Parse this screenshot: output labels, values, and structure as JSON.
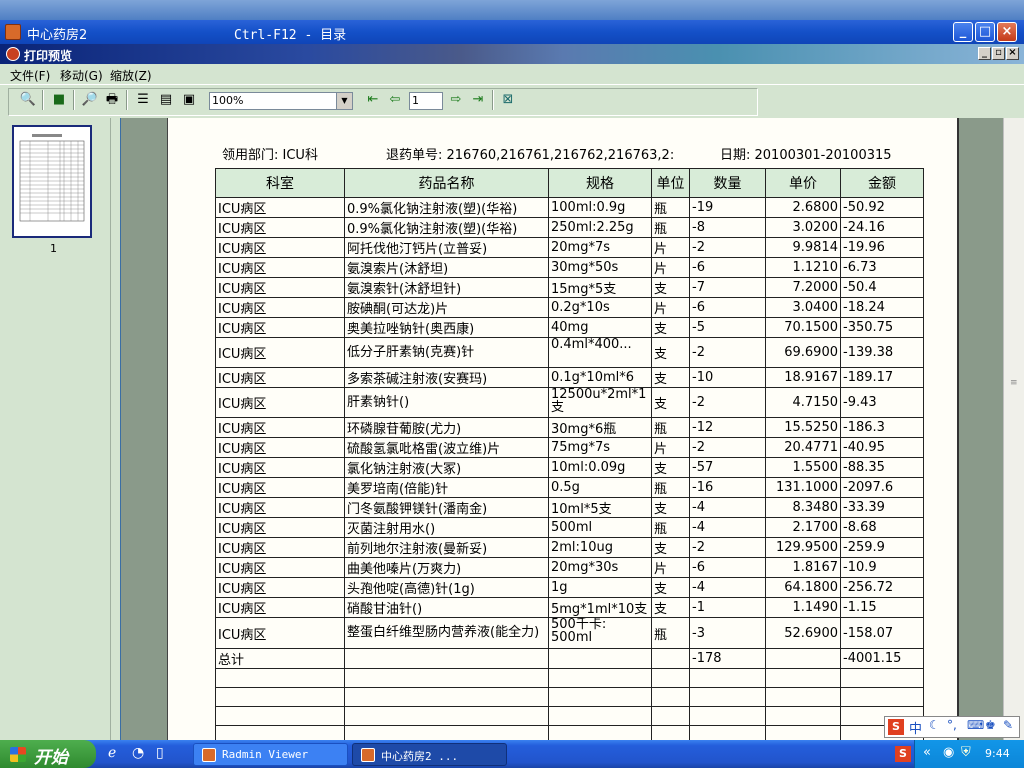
{
  "window": {
    "title": "中心药房2",
    "shortcut": "Ctrl-F12 - 目录"
  },
  "preview": {
    "title": "打印预览"
  },
  "menu": {
    "file": "文件(F)",
    "move": "移动(G)",
    "zoom": "缩放(Z)"
  },
  "toolbar": {
    "zoom_value": "100%",
    "page_value": "1"
  },
  "thumbnail": {
    "page_label": "1"
  },
  "report": {
    "dept_label": "领用部门: ICU科",
    "ticket_label": "退药单号: 216760,216761,216762,216763,2:",
    "date_label": "日期: 20100301-20100315",
    "headers": [
      "科室",
      "药品名称",
      "规格",
      "单位",
      "数量",
      "单价",
      "金额"
    ],
    "rows": [
      [
        "ICU病区",
        "0.9%氯化钠注射液(塑)(华裕)",
        "100ml:0.9g",
        "瓶",
        "-19",
        "2.6800",
        "-50.92"
      ],
      [
        "ICU病区",
        "0.9%氯化钠注射液(塑)(华裕)",
        "250ml:2.25g",
        "瓶",
        "-8",
        "3.0200",
        "-24.16"
      ],
      [
        "ICU病区",
        "阿托伐他汀钙片(立普妥)",
        "20mg*7s",
        "片",
        "-2",
        "9.9814",
        "-19.96"
      ],
      [
        "ICU病区",
        "氨溴索片(沐舒坦)",
        "30mg*50s",
        "片",
        "-6",
        "1.1210",
        "-6.73"
      ],
      [
        "ICU病区",
        "氨溴索针(沐舒坦针)",
        "15mg*5支",
        "支",
        "-7",
        "7.2000",
        "-50.4"
      ],
      [
        "ICU病区",
        "胺碘酮(可达龙)片",
        "0.2g*10s",
        "片",
        "-6",
        "3.0400",
        "-18.24"
      ],
      [
        "ICU病区",
        "奥美拉唑钠针(奥西康)",
        "40mg",
        "支",
        "-5",
        "70.1500",
        "-350.75"
      ],
      [
        "ICU病区",
        "低分子肝素钠(克赛)针",
        "0.4ml*400...",
        "支",
        "-2",
        "69.6900",
        "-139.38"
      ],
      [
        "ICU病区",
        "多索茶碱注射液(安赛玛)",
        "0.1g*10ml*6",
        "支",
        "-10",
        "18.9167",
        "-189.17"
      ],
      [
        "ICU病区",
        "肝素钠针()",
        "12500u*2ml*1\n支",
        "支",
        "-2",
        "4.7150",
        "-9.43"
      ],
      [
        "ICU病区",
        "环磷腺苷葡胺(尤力)",
        "30mg*6瓶",
        "瓶",
        "-12",
        "15.5250",
        "-186.3"
      ],
      [
        "ICU病区",
        "硫酸氢氯吡格雷(波立维)片",
        "75mg*7s",
        "片",
        "-2",
        "20.4771",
        "-40.95"
      ],
      [
        "ICU病区",
        "氯化钠注射液(大冢)",
        "10ml:0.09g",
        "支",
        "-57",
        "1.5500",
        "-88.35"
      ],
      [
        "ICU病区",
        "美罗培南(倍能)针",
        "0.5g",
        "瓶",
        "-16",
        "131.1000",
        "-2097.6"
      ],
      [
        "ICU病区",
        "门冬氨酸钾镁针(潘南金)",
        "10ml*5支",
        "支",
        "-4",
        "8.3480",
        "-33.39"
      ],
      [
        "ICU病区",
        "灭菌注射用水()",
        "500ml",
        "瓶",
        "-4",
        "2.1700",
        "-8.68"
      ],
      [
        "ICU病区",
        "前列地尔注射液(曼新妥)",
        "2ml:10ug",
        "支",
        "-2",
        "129.9500",
        "-259.9"
      ],
      [
        "ICU病区",
        "曲美他嗪片(万爽力)",
        "20mg*30s",
        "片",
        "-6",
        "1.8167",
        "-10.9"
      ],
      [
        "ICU病区",
        "头孢他啶(高德)针(1g)",
        "1g",
        "支",
        "-4",
        "64.1800",
        "-256.72"
      ],
      [
        "ICU病区",
        "硝酸甘油针()",
        "5mg*1ml*10支",
        "支",
        "-1",
        "1.1490",
        "-1.15"
      ],
      [
        "ICU病区",
        "整蛋白纤维型肠内营养液(能全力)",
        "500千卡:\n500ml",
        "瓶",
        "-3",
        "52.6900",
        "-158.07"
      ]
    ],
    "total": {
      "label": "总计",
      "quantity": "-178",
      "amount": "-4001.15"
    }
  },
  "taskbar": {
    "start": "开始",
    "tasks": [
      {
        "label": "Radmin Viewer"
      },
      {
        "label": "中心药房2     ..."
      }
    ],
    "clock": "9:44",
    "ime": "中"
  }
}
